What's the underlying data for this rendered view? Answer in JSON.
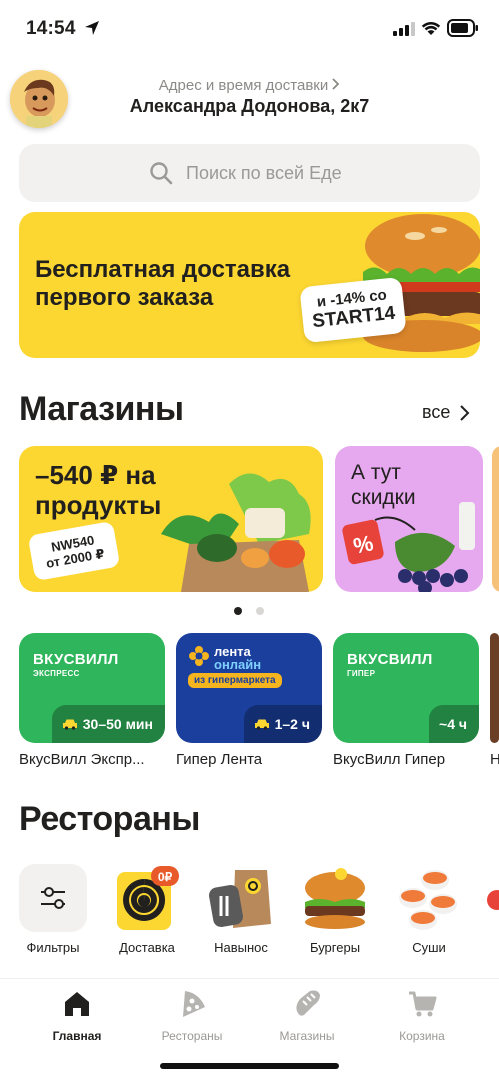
{
  "status_bar": {
    "time": "14:54"
  },
  "header": {
    "address_label": "Адрес и время доставки",
    "address_value": "Александра Додонова, 2к7"
  },
  "search": {
    "placeholder": "Поиск по всей Еде"
  },
  "banner": {
    "title_line1": "Бесплатная доставка",
    "title_line2": "первого заказа",
    "promo_line1": "и -14% со",
    "promo_line2": "START14"
  },
  "shops_section": {
    "title": "Магазины",
    "all_label": "все",
    "promos": [
      {
        "title_line1": "–540 ₽ на",
        "title_line2": "продукты",
        "code_line1": "NW540",
        "code_line2": "от 2000 ₽"
      },
      {
        "title_line1": "А тут",
        "title_line2": "скидки"
      }
    ],
    "carousel_active_index": 0,
    "carousel_count": 2,
    "stores": [
      {
        "logo": "ВКУСВИЛЛ",
        "sub": "ЭКСПРЕСС",
        "time": "30–50 мин",
        "name": "ВкусВилл Экспр...",
        "color": "#2fb55b"
      },
      {
        "logo_line1": "лента",
        "logo_line2": "онлайн",
        "sub": "из гипермаркета",
        "time": "1–2 ч",
        "name": "Гипер Лента",
        "color": "#1a3f9c"
      },
      {
        "logo": "ВКУСВИЛЛ",
        "sub": "ГИПЕР",
        "time": "~4 ч",
        "name": "ВкусВилл Гипер",
        "color": "#2fb55b"
      },
      {
        "name": "Н",
        "color": "#6b3e26"
      }
    ]
  },
  "restaurants_section": {
    "title": "Рестораны",
    "categories": [
      {
        "label": "Фильтры",
        "icon": "filters-icon"
      },
      {
        "label": "Доставка",
        "icon": "delivery-icon",
        "badge": "0₽"
      },
      {
        "label": "Навынос",
        "icon": "takeaway-icon"
      },
      {
        "label": "Бургеры",
        "icon": "burger-icon"
      },
      {
        "label": "Суши",
        "icon": "sushi-icon"
      }
    ]
  },
  "tab_bar": {
    "tabs": [
      {
        "label": "Главная",
        "icon": "home-icon",
        "active": true
      },
      {
        "label": "Рестораны",
        "icon": "pizza-icon",
        "active": false
      },
      {
        "label": "Магазины",
        "icon": "bread-icon",
        "active": false
      },
      {
        "label": "Корзина",
        "icon": "cart-icon",
        "active": false
      }
    ]
  },
  "colors": {
    "brand_yellow": "#fcd732",
    "pink_card": "#e6a8ee",
    "vkusvill_green": "#2fb55b",
    "lenta_blue": "#1a3f9c",
    "text_primary": "#21201f",
    "text_muted": "#9a9996"
  }
}
